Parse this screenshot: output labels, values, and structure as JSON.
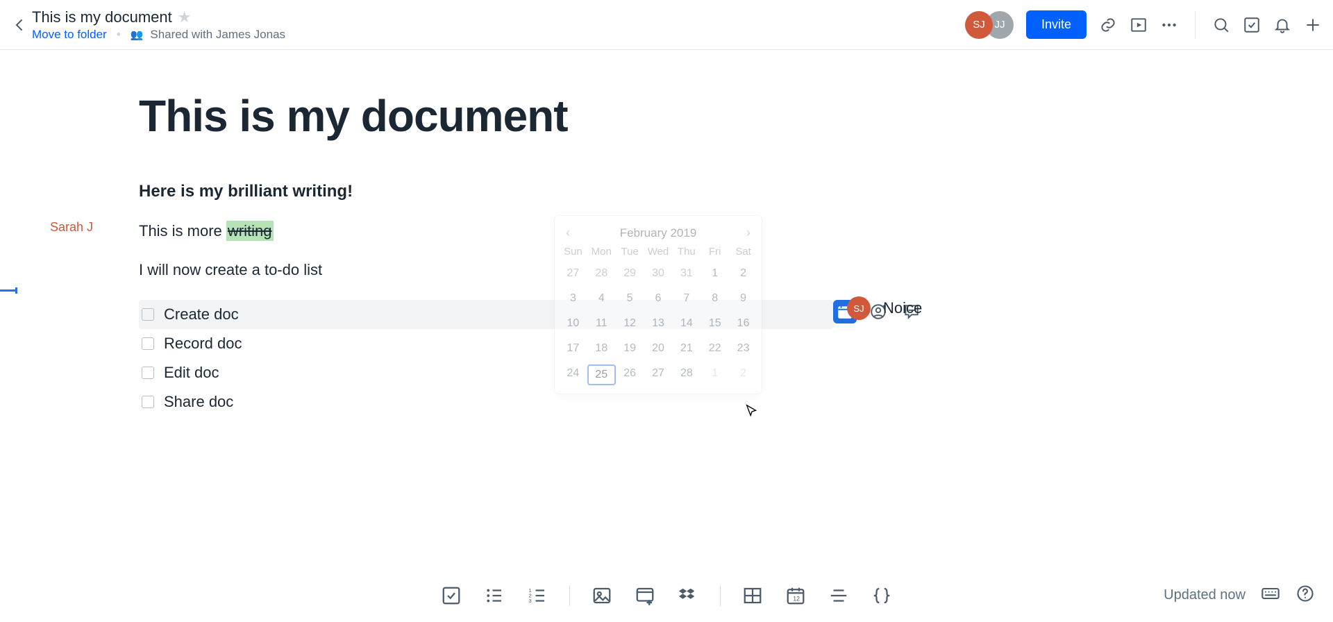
{
  "header": {
    "doc_title": "This is my document",
    "move_link": "Move to folder",
    "shared_with": "Shared with James Jonas",
    "invite_label": "Invite",
    "avatars": {
      "a1": "SJ",
      "a2": "JJ"
    }
  },
  "document": {
    "author": "Sarah J",
    "h1": "This is my document",
    "sub": "Here is my brilliant writing!",
    "line2_pre": "This is more ",
    "line2_hl": "writing",
    "line3": "I will now create a to-do list",
    "todos": {
      "t0": "Create doc",
      "t1": "Record doc",
      "t2": "Edit doc",
      "t3": "Share doc"
    }
  },
  "comment": {
    "avatar": "SJ",
    "text": "Noice"
  },
  "calendar": {
    "title": "February 2019",
    "prev": "‹",
    "next": "›",
    "dow": {
      "d0": "Sun",
      "d1": "Mon",
      "d2": "Tue",
      "d3": "Wed",
      "d4": "Thu",
      "d5": "Fri",
      "d6": "Sat"
    },
    "days": [
      {
        "n": "27",
        "cls": "out"
      },
      {
        "n": "28",
        "cls": "out"
      },
      {
        "n": "29",
        "cls": "out"
      },
      {
        "n": "30",
        "cls": "out"
      },
      {
        "n": "31",
        "cls": "out"
      },
      {
        "n": "1",
        "cls": "in"
      },
      {
        "n": "2",
        "cls": "in"
      },
      {
        "n": "3",
        "cls": "in"
      },
      {
        "n": "4",
        "cls": "in"
      },
      {
        "n": "5",
        "cls": "in"
      },
      {
        "n": "6",
        "cls": "in"
      },
      {
        "n": "7",
        "cls": "in"
      },
      {
        "n": "8",
        "cls": "in"
      },
      {
        "n": "9",
        "cls": "in"
      },
      {
        "n": "10",
        "cls": "in"
      },
      {
        "n": "11",
        "cls": "in"
      },
      {
        "n": "12",
        "cls": "in"
      },
      {
        "n": "13",
        "cls": "in"
      },
      {
        "n": "14",
        "cls": "in"
      },
      {
        "n": "15",
        "cls": "in"
      },
      {
        "n": "16",
        "cls": "in"
      },
      {
        "n": "17",
        "cls": "in"
      },
      {
        "n": "18",
        "cls": "in"
      },
      {
        "n": "19",
        "cls": "in"
      },
      {
        "n": "20",
        "cls": "in"
      },
      {
        "n": "21",
        "cls": "in"
      },
      {
        "n": "22",
        "cls": "in"
      },
      {
        "n": "23",
        "cls": "in"
      },
      {
        "n": "24",
        "cls": "in"
      },
      {
        "n": "25",
        "cls": "today"
      },
      {
        "n": "26",
        "cls": "in"
      },
      {
        "n": "27",
        "cls": "in"
      },
      {
        "n": "28",
        "cls": "in"
      },
      {
        "n": "1",
        "cls": "out2"
      },
      {
        "n": "2",
        "cls": "out2"
      }
    ]
  },
  "toolbar_icons": {
    "checkbox": "checkbox-icon",
    "bullet": "bullet-list-icon",
    "numbered": "numbered-list-icon",
    "image": "image-icon",
    "media": "media-embed-icon",
    "dropbox": "dropbox-icon",
    "table": "table-icon",
    "cal": "calendar-insert-icon",
    "divider": "divider-icon",
    "code": "code-block-icon"
  },
  "status": {
    "text": "Updated now"
  }
}
